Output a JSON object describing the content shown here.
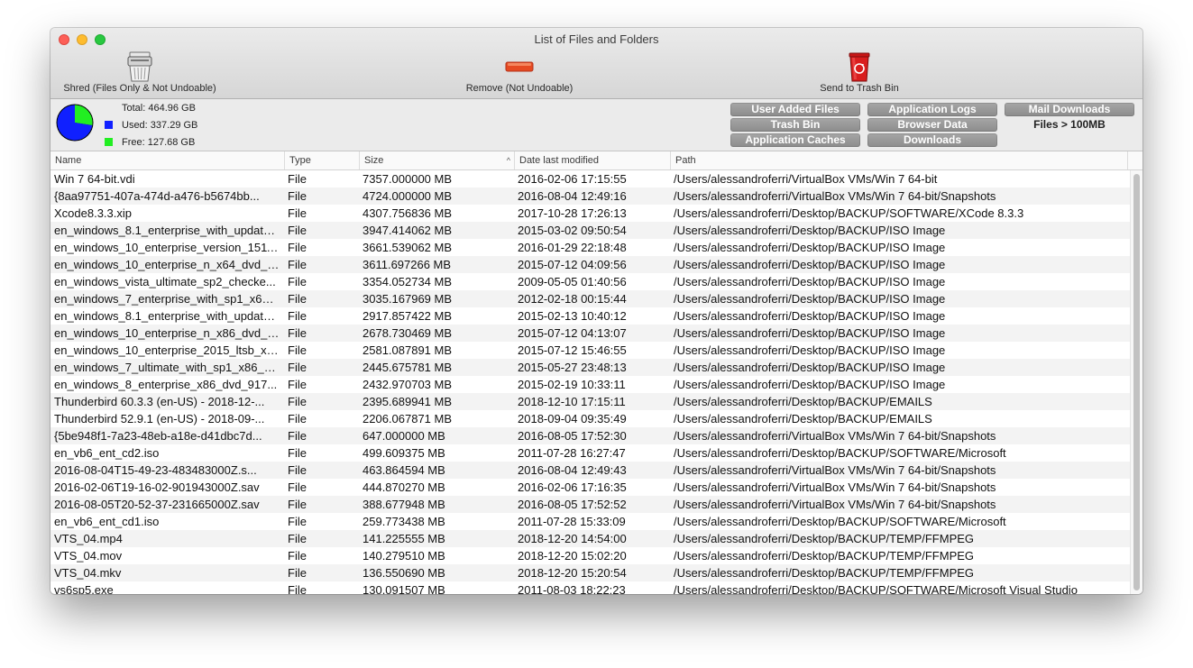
{
  "window": {
    "title": "List of Files and Folders"
  },
  "toolbar": {
    "shred_label": "Shred (Files Only & Not Undoable)",
    "remove_label": "Remove (Not Undoable)",
    "trash_label": "Send to Trash Bin"
  },
  "disk": {
    "total": "Total: 464.96 GB",
    "used": "Used: 337.29 GB",
    "free": "Free: 127.68 GB",
    "used_fraction": 0.7254,
    "used_color": "#1020ff",
    "free_color": "#22ee22"
  },
  "filters": {
    "user_added": "User Added Files",
    "trash_bin": "Trash Bin",
    "app_caches": "Application Caches",
    "app_logs": "Application Logs",
    "browser_data": "Browser Data",
    "downloads": "Downloads",
    "mail_downloads": "Mail Downloads",
    "files_100mb": "Files > 100MB"
  },
  "columns": {
    "name": "Name",
    "type": "Type",
    "size": "Size",
    "date": "Date last modified",
    "path": "Path"
  },
  "rows": [
    {
      "name": "Win 7 64-bit.vdi",
      "type": "File",
      "size": "7357.000000 MB",
      "date": "2016-02-06 17:15:55",
      "path": "/Users/alessandroferri/VirtualBox VMs/Win 7 64-bit"
    },
    {
      "name": "{8aa97751-407a-474d-a476-b5674bb...",
      "type": "File",
      "size": "4724.000000 MB",
      "date": "2016-08-04 12:49:16",
      "path": "/Users/alessandroferri/VirtualBox VMs/Win 7 64-bit/Snapshots"
    },
    {
      "name": "Xcode8.3.3.xip",
      "type": "File",
      "size": "4307.756836 MB",
      "date": "2017-10-28 17:26:13",
      "path": "/Users/alessandroferri/Desktop/BACKUP/SOFTWARE/XCode 8.3.3"
    },
    {
      "name": "en_windows_8.1_enterprise_with_update...",
      "type": "File",
      "size": "3947.414062 MB",
      "date": "2015-03-02 09:50:54",
      "path": "/Users/alessandroferri/Desktop/BACKUP/ISO Image"
    },
    {
      "name": "en_windows_10_enterprise_version_1511_...",
      "type": "File",
      "size": "3661.539062 MB",
      "date": "2016-01-29 22:18:48",
      "path": "/Users/alessandroferri/Desktop/BACKUP/ISO Image"
    },
    {
      "name": "en_windows_10_enterprise_n_x64_dvd_6...",
      "type": "File",
      "size": "3611.697266 MB",
      "date": "2015-07-12 04:09:56",
      "path": "/Users/alessandroferri/Desktop/BACKUP/ISO Image"
    },
    {
      "name": "en_windows_vista_ultimate_sp2_checke...",
      "type": "File",
      "size": "3354.052734 MB",
      "date": "2009-05-05 01:40:56",
      "path": "/Users/alessandroferri/Desktop/BACKUP/ISO Image"
    },
    {
      "name": "en_windows_7_enterprise_with_sp1_x64_...",
      "type": "File",
      "size": "3035.167969 MB",
      "date": "2012-02-18 00:15:44",
      "path": "/Users/alessandroferri/Desktop/BACKUP/ISO Image"
    },
    {
      "name": "en_windows_8.1_enterprise_with_update...",
      "type": "File",
      "size": "2917.857422 MB",
      "date": "2015-02-13 10:40:12",
      "path": "/Users/alessandroferri/Desktop/BACKUP/ISO Image"
    },
    {
      "name": "en_windows_10_enterprise_n_x86_dvd_6...",
      "type": "File",
      "size": "2678.730469 MB",
      "date": "2015-07-12 04:13:07",
      "path": "/Users/alessandroferri/Desktop/BACKUP/ISO Image"
    },
    {
      "name": "en_windows_10_enterprise_2015_ltsb_x8...",
      "type": "File",
      "size": "2581.087891 MB",
      "date": "2015-07-12 15:46:55",
      "path": "/Users/alessandroferri/Desktop/BACKUP/ISO Image"
    },
    {
      "name": "en_windows_7_ultimate_with_sp1_x86_dv...",
      "type": "File",
      "size": "2445.675781 MB",
      "date": "2015-05-27 23:48:13",
      "path": "/Users/alessandroferri/Desktop/BACKUP/ISO Image"
    },
    {
      "name": "en_windows_8_enterprise_x86_dvd_917...",
      "type": "File",
      "size": "2432.970703 MB",
      "date": "2015-02-19 10:33:11",
      "path": "/Users/alessandroferri/Desktop/BACKUP/ISO Image"
    },
    {
      "name": "Thunderbird 60.3.3 (en-US) - 2018-12-...",
      "type": "File",
      "size": "2395.689941 MB",
      "date": "2018-12-10 17:15:11",
      "path": "/Users/alessandroferri/Desktop/BACKUP/EMAILS"
    },
    {
      "name": "Thunderbird 52.9.1 (en-US) - 2018-09-...",
      "type": "File",
      "size": "2206.067871 MB",
      "date": "2018-09-04 09:35:49",
      "path": "/Users/alessandroferri/Desktop/BACKUP/EMAILS"
    },
    {
      "name": "{5be948f1-7a23-48eb-a18e-d41dbc7d...",
      "type": "File",
      "size": "647.000000 MB",
      "date": "2016-08-05 17:52:30",
      "path": "/Users/alessandroferri/VirtualBox VMs/Win 7 64-bit/Snapshots"
    },
    {
      "name": "en_vb6_ent_cd2.iso",
      "type": "File",
      "size": "499.609375 MB",
      "date": "2011-07-28 16:27:47",
      "path": "/Users/alessandroferri/Desktop/BACKUP/SOFTWARE/Microsoft"
    },
    {
      "name": "2016-08-04T15-49-23-483483000Z.s...",
      "type": "File",
      "size": "463.864594 MB",
      "date": "2016-08-04 12:49:43",
      "path": "/Users/alessandroferri/VirtualBox VMs/Win 7 64-bit/Snapshots"
    },
    {
      "name": "2016-02-06T19-16-02-901943000Z.sav",
      "type": "File",
      "size": "444.870270 MB",
      "date": "2016-02-06 17:16:35",
      "path": "/Users/alessandroferri/VirtualBox VMs/Win 7 64-bit/Snapshots"
    },
    {
      "name": "2016-08-05T20-52-37-231665000Z.sav",
      "type": "File",
      "size": "388.677948 MB",
      "date": "2016-08-05 17:52:52",
      "path": "/Users/alessandroferri/VirtualBox VMs/Win 7 64-bit/Snapshots"
    },
    {
      "name": "en_vb6_ent_cd1.iso",
      "type": "File",
      "size": "259.773438 MB",
      "date": "2011-07-28 15:33:09",
      "path": "/Users/alessandroferri/Desktop/BACKUP/SOFTWARE/Microsoft"
    },
    {
      "name": "VTS_04.mp4",
      "type": "File",
      "size": "141.225555 MB",
      "date": "2018-12-20 14:54:00",
      "path": "/Users/alessandroferri/Desktop/BACKUP/TEMP/FFMPEG"
    },
    {
      "name": "VTS_04.mov",
      "type": "File",
      "size": "140.279510 MB",
      "date": "2018-12-20 15:02:20",
      "path": "/Users/alessandroferri/Desktop/BACKUP/TEMP/FFMPEG"
    },
    {
      "name": "VTS_04.mkv",
      "type": "File",
      "size": "136.550690 MB",
      "date": "2018-12-20 15:20:54",
      "path": "/Users/alessandroferri/Desktop/BACKUP/TEMP/FFMPEG"
    },
    {
      "name": "vs6sp5.exe",
      "type": "File",
      "size": "130.091507 MB",
      "date": "2011-08-03 18:22:23",
      "path": "/Users/alessandroferri/Desktop/BACKUP/SOFTWARE/Microsoft Visual Studio"
    }
  ]
}
